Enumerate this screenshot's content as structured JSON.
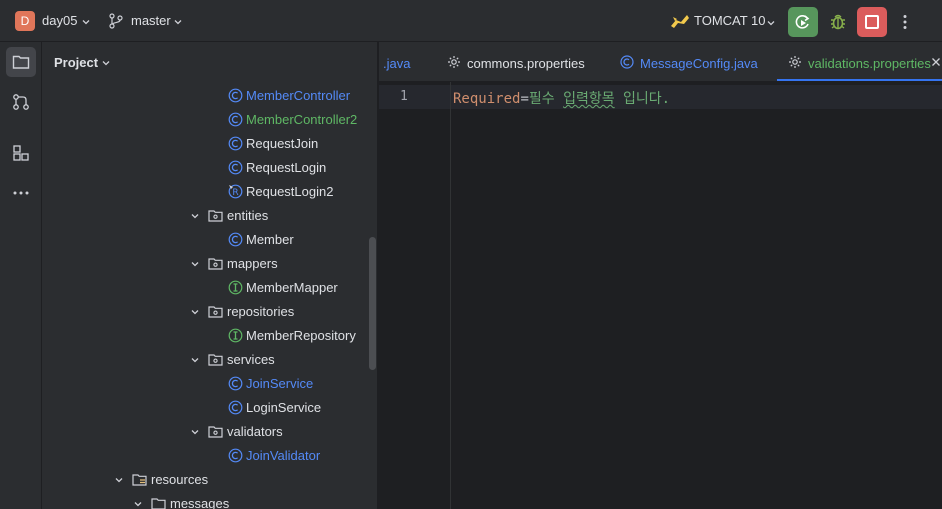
{
  "titlebar": {
    "project_badge": "D",
    "project_name": "day05",
    "branch": "master",
    "run_config": "TOMCAT 10",
    "colors": {
      "run": "#57965c",
      "stop": "#db5c5c",
      "debug_icon": "#88b04b",
      "badge": "#e0765a"
    }
  },
  "toolstrip": {
    "items": [
      "folder-icon",
      "vcs-icon",
      "structure-icon",
      "more-icon"
    ]
  },
  "project_panel": {
    "title": "Project",
    "tree": [
      {
        "label": "MemberController",
        "kind": "class",
        "color": "#548af7"
      },
      {
        "label": "MemberController2",
        "kind": "class",
        "color": "#5fb865"
      },
      {
        "label": "RequestJoin",
        "kind": "class",
        "color": "#dfe1e5"
      },
      {
        "label": "RequestLogin",
        "kind": "class",
        "color": "#dfe1e5"
      },
      {
        "label": "RequestLogin2",
        "kind": "record",
        "color": "#dfe1e5"
      },
      {
        "label": "entities",
        "kind": "package",
        "color": "#dfe1e5"
      },
      {
        "label": "Member",
        "kind": "class",
        "color": "#dfe1e5"
      },
      {
        "label": "mappers",
        "kind": "package",
        "color": "#dfe1e5"
      },
      {
        "label": "MemberMapper",
        "kind": "interface",
        "color": "#dfe1e5"
      },
      {
        "label": "repositories",
        "kind": "package",
        "color": "#dfe1e5"
      },
      {
        "label": "MemberRepository",
        "kind": "interface",
        "color": "#dfe1e5"
      },
      {
        "label": "services",
        "kind": "package",
        "color": "#dfe1e5"
      },
      {
        "label": "JoinService",
        "kind": "class",
        "color": "#548af7"
      },
      {
        "label": "LoginService",
        "kind": "class",
        "color": "#dfe1e5"
      },
      {
        "label": "validators",
        "kind": "package",
        "color": "#dfe1e5"
      },
      {
        "label": "JoinValidator",
        "kind": "class",
        "color": "#548af7"
      },
      {
        "label": "resources",
        "kind": "resources",
        "color": "#dfe1e5"
      },
      {
        "label": "messages",
        "kind": "folder",
        "color": "#dfe1e5"
      }
    ]
  },
  "editor": {
    "tabs": [
      {
        "label": ".java",
        "icon": "none",
        "color": "#548af7",
        "active": false
      },
      {
        "label": "commons.properties",
        "icon": "gear-icon",
        "color": "#dfe1e5",
        "active": false
      },
      {
        "label": "MessageConfig.java",
        "icon": "class-icon",
        "color": "#548af7",
        "active": false
      },
      {
        "label": "validations.properties",
        "icon": "gear-icon",
        "color": "#5fb865",
        "active": true
      }
    ],
    "line_number": "1",
    "code": {
      "key": "Required",
      "eq": "=",
      "value_1": "필수 ",
      "value_typo": "입력항목",
      "value_2": " 입니다."
    }
  }
}
